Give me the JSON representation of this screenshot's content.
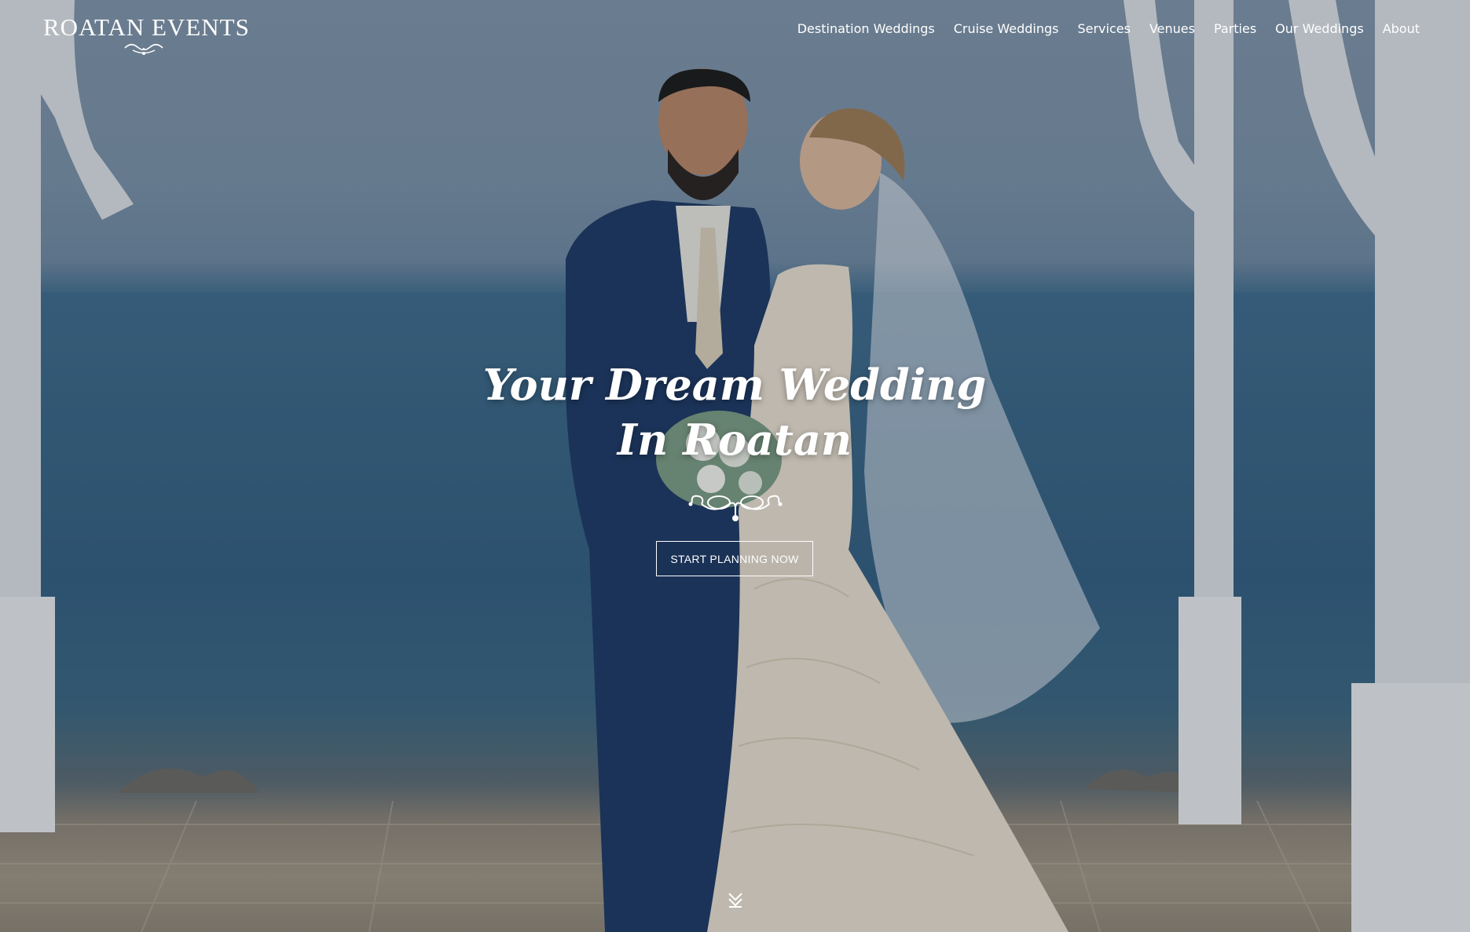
{
  "header": {
    "logo_text": "ROATAN EVENTS",
    "logo_icon": "flourish-ornament-icon"
  },
  "nav": {
    "items": [
      {
        "label": "Destination Weddings"
      },
      {
        "label": "Cruise Weddings"
      },
      {
        "label": "Services"
      },
      {
        "label": "Venues"
      },
      {
        "label": "Parties"
      },
      {
        "label": "Our Weddings"
      },
      {
        "label": "About"
      }
    ]
  },
  "hero": {
    "headline": "Your Dream Wedding In Roatan",
    "divider_icon": "flourish-divider-icon",
    "cta_label": "START PLANNING NOW",
    "scroll_icon": "double-chevron-down-icon",
    "background_image": "couple-at-seaside-gazebo-photo"
  },
  "colors": {
    "text": "#ffffff",
    "sky": "#7f93a8",
    "sea": "#3a6585",
    "floor": "#9f9584",
    "suit": "#1f3a64",
    "dress": "#e9e1d6"
  }
}
